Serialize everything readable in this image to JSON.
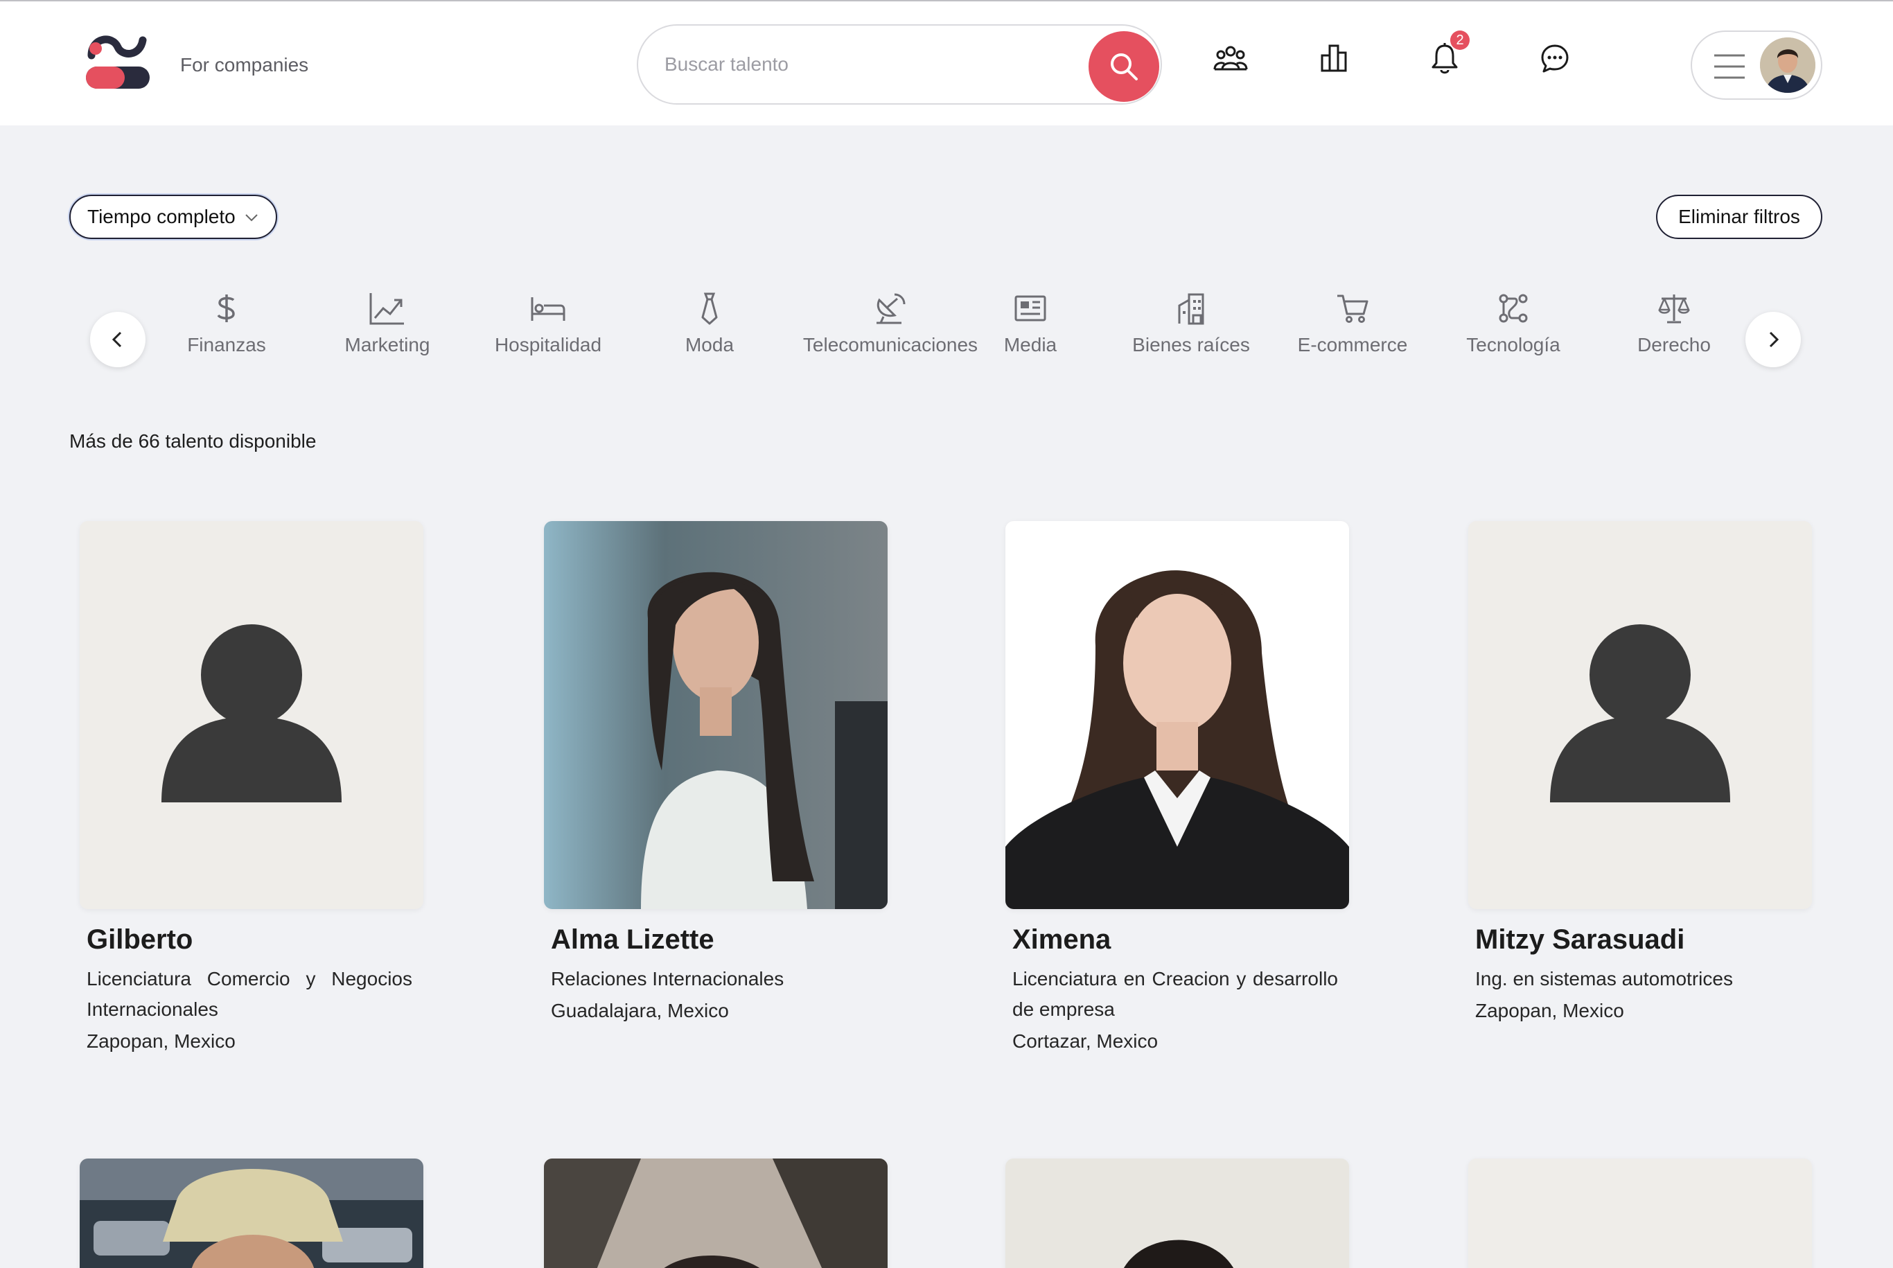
{
  "header": {
    "tagline": "For companies",
    "search": {
      "placeholder": "Buscar talento"
    },
    "nav": [
      {
        "icon": "team-icon"
      },
      {
        "icon": "chart-bars-icon"
      },
      {
        "icon": "bell-icon",
        "badge": "2"
      },
      {
        "icon": "chat-icon"
      }
    ]
  },
  "filters": {
    "job_type": "Tiempo completo",
    "clear_label": "Eliminar filtros"
  },
  "categories": [
    {
      "label": "Finanzas",
      "icon": "dollar-icon"
    },
    {
      "label": "Marketing",
      "icon": "trend-chart-icon"
    },
    {
      "label": "Hospitalidad",
      "icon": "bed-icon"
    },
    {
      "label": "Moda",
      "icon": "tie-icon"
    },
    {
      "label": "Telecomunicaciones",
      "icon": "satellite-dish-icon"
    },
    {
      "label": "Media",
      "icon": "newspaper-icon"
    },
    {
      "label": "Bienes raíces",
      "icon": "building-icon"
    },
    {
      "label": "E-commerce",
      "icon": "cart-icon"
    },
    {
      "label": "Tecnología",
      "icon": "nodes-icon"
    },
    {
      "label": "Derecho",
      "icon": "scales-icon"
    }
  ],
  "results": {
    "count_text": "Más de 66 talento disponible"
  },
  "candidates": [
    {
      "name": "Gilberto",
      "degree": "Licenciatura Comercio y Negocios Internacionales",
      "location": "Zapopan, Mexico",
      "photo": "placeholder"
    },
    {
      "name": "Alma Lizette",
      "degree": "Relaciones Internacionales",
      "location": "Guadalajara, Mexico",
      "photo": "portrait"
    },
    {
      "name": "Ximena",
      "degree": "Licenciatura en Creacion y desarrollo de empresa",
      "location": "Cortazar, Mexico",
      "photo": "portrait"
    },
    {
      "name": "Mitzy Sarasuadi",
      "degree": "Ing. en sistemas automotrices",
      "location": "Zapopan, Mexico",
      "photo": "placeholder"
    }
  ],
  "colors": {
    "accent": "#e5505f",
    "navy": "#1f2033",
    "page_bg": "#f1f2f5"
  }
}
